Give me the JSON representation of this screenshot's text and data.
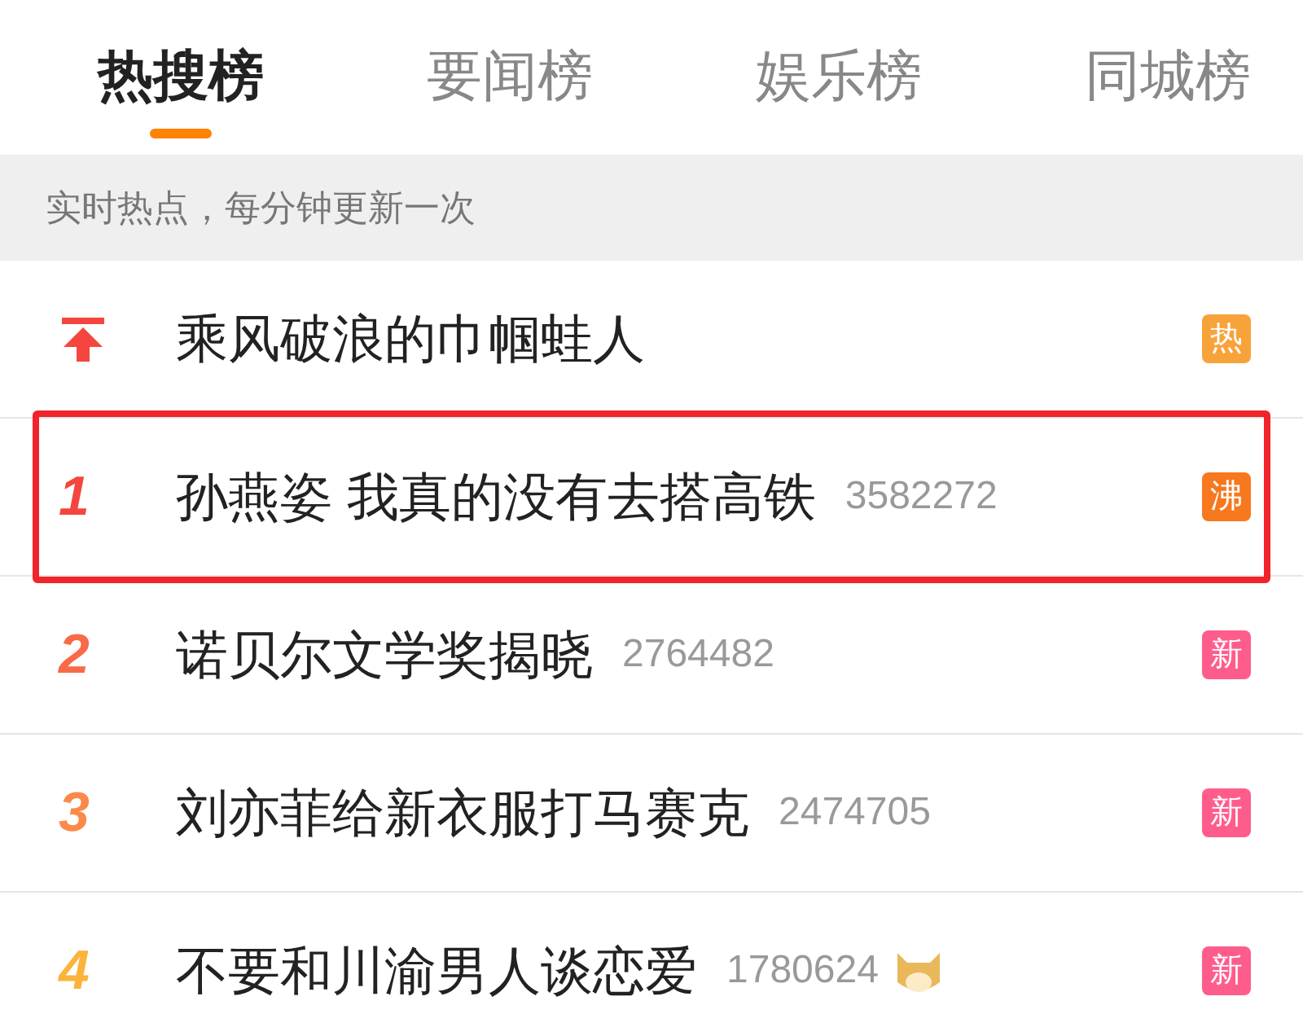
{
  "tabs": [
    {
      "label": "热搜榜",
      "selected": true
    },
    {
      "label": "要闻榜",
      "selected": false
    },
    {
      "label": "娱乐榜",
      "selected": false
    },
    {
      "label": "同城榜",
      "selected": false
    }
  ],
  "notice": "实时热点，每分钟更新一次",
  "rows": [
    {
      "kind": "pinned",
      "title": "乘风破浪的巾帼蛙人",
      "badge": {
        "label": "热",
        "color": "#f8a33a"
      },
      "highlighted": false
    },
    {
      "kind": "ranked",
      "rank": "1",
      "color": "#f4463e",
      "title": "孙燕姿 我真的没有去搭高铁",
      "count": "3582272",
      "badge": {
        "label": "沸",
        "color": "#f7781f"
      },
      "highlighted": true
    },
    {
      "kind": "ranked",
      "rank": "2",
      "color": "#f86a48",
      "title": "诺贝尔文学奖揭晓",
      "count": "2764482",
      "badge": {
        "label": "新",
        "color": "#fe5d8c"
      },
      "highlighted": false
    },
    {
      "kind": "ranked",
      "rank": "3",
      "color": "#fb8a4a",
      "title": "刘亦菲给新衣服打马赛克",
      "count": "2474705",
      "badge": {
        "label": "新",
        "color": "#fe5d8c"
      },
      "highlighted": false
    },
    {
      "kind": "ranked",
      "rank": "4",
      "color": "#fbb33a",
      "title": "不要和川渝男人谈恋爱",
      "count": "1780624",
      "emoji": true,
      "badge": {
        "label": "新",
        "color": "#fe5d8c"
      },
      "highlighted": false
    }
  ]
}
